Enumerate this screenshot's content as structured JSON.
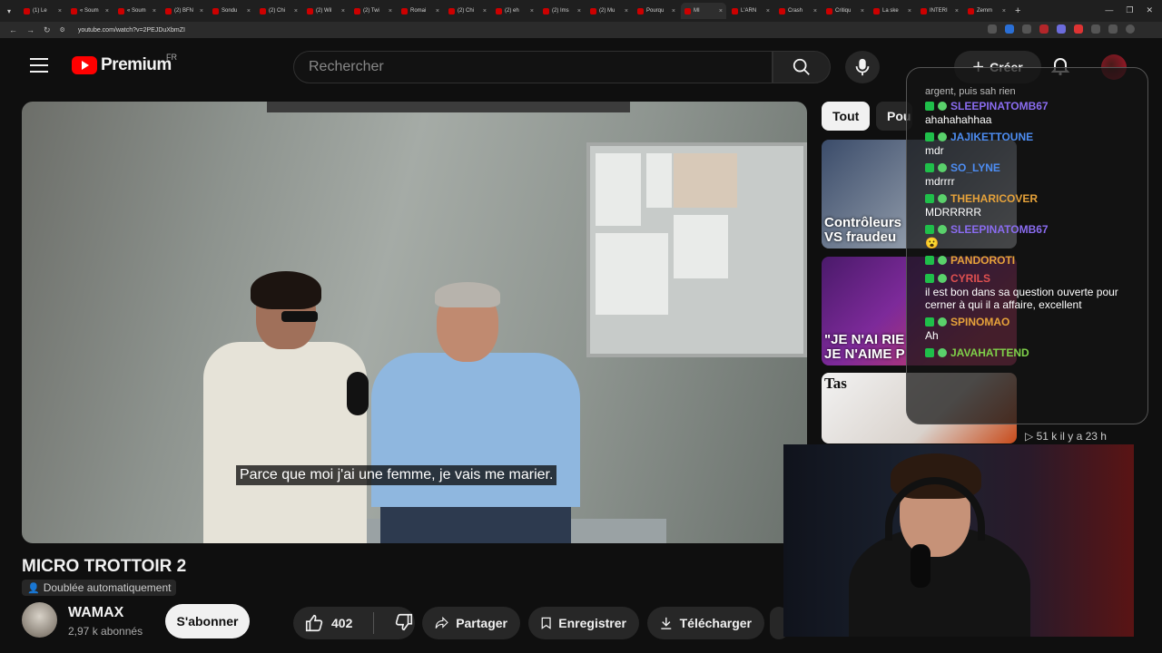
{
  "browser": {
    "tabs": [
      {
        "label": "(1) Le"
      },
      {
        "label": "« Soum"
      },
      {
        "label": "« Soum"
      },
      {
        "label": "(2) BFN"
      },
      {
        "label": "Sondu"
      },
      {
        "label": "(2) Chi"
      },
      {
        "label": "(2) Wil"
      },
      {
        "label": "(2) Twi"
      },
      {
        "label": "Romai"
      },
      {
        "label": "(2) Chi"
      },
      {
        "label": "(2) eh"
      },
      {
        "label": "(2) Ims"
      },
      {
        "label": "(2) Mu"
      },
      {
        "label": "Pourqu"
      },
      {
        "label": "MI"
      },
      {
        "label": "L'ARN"
      },
      {
        "label": "Crash"
      },
      {
        "label": "Critiqu"
      },
      {
        "label": "La ske"
      },
      {
        "label": "INTERI"
      },
      {
        "label": "Zemm"
      }
    ],
    "url": "youtube.com/watch?v=2PEJDuXbmZI"
  },
  "header": {
    "logo_text": "Premium",
    "country": "FR",
    "search_placeholder": "Rechercher",
    "create_label": "Créer"
  },
  "video": {
    "subtitle": "Parce que moi j'ai une femme, je vais me marier.",
    "title": "MICRO TROTTOIR 2",
    "dub_badge": "Doublée automatiquement"
  },
  "channel": {
    "name": "WAMAX",
    "subscribers": "2,97 k abonnés",
    "subscribe_label": "S'abonner"
  },
  "actions": {
    "likes": "402",
    "share": "Partager",
    "save": "Enregistrer",
    "download": "Télécharger"
  },
  "sidebar": {
    "chips": [
      "Tout",
      "Pou"
    ],
    "thumbs": [
      {
        "text": "Contrôleurs VS fraudeu"
      },
      {
        "text": "\"JE N'AI RIE JE N'AIME P"
      },
      {
        "text": "Tas"
      }
    ],
    "meta": "▷ 51 k   il y a 23 h"
  },
  "chat": {
    "older": "argent, puis sah rien",
    "messages": [
      {
        "user": "SLEEPINATOMB67",
        "color": "#8a6cf0",
        "text": "ahahahahhaa"
      },
      {
        "user": "JAJIKETTOUNE",
        "color": "#4d8df2",
        "text": "mdr"
      },
      {
        "user": "SO_LYNE",
        "color": "#4d8df2",
        "text": "mdrrrr"
      },
      {
        "user": "THEHARICOVER",
        "color": "#e6a23a",
        "text": "MDRRRRR"
      },
      {
        "user": "SLEEPINATOMB67",
        "color": "#8a6cf0",
        "text": "😮"
      },
      {
        "user": "PANDOROTI",
        "color": "#e6a23a",
        "text": ""
      },
      {
        "user": "CYRILS",
        "color": "#e05050",
        "text": "il est bon dans sa question ouverte pour cerner à qui il a affaire, excellent"
      },
      {
        "user": "SPINOMAO",
        "color": "#e6a23a",
        "text": "Ah"
      },
      {
        "user": "JAVAHATTEND",
        "color": "#7fd14a",
        "text": ""
      }
    ]
  }
}
